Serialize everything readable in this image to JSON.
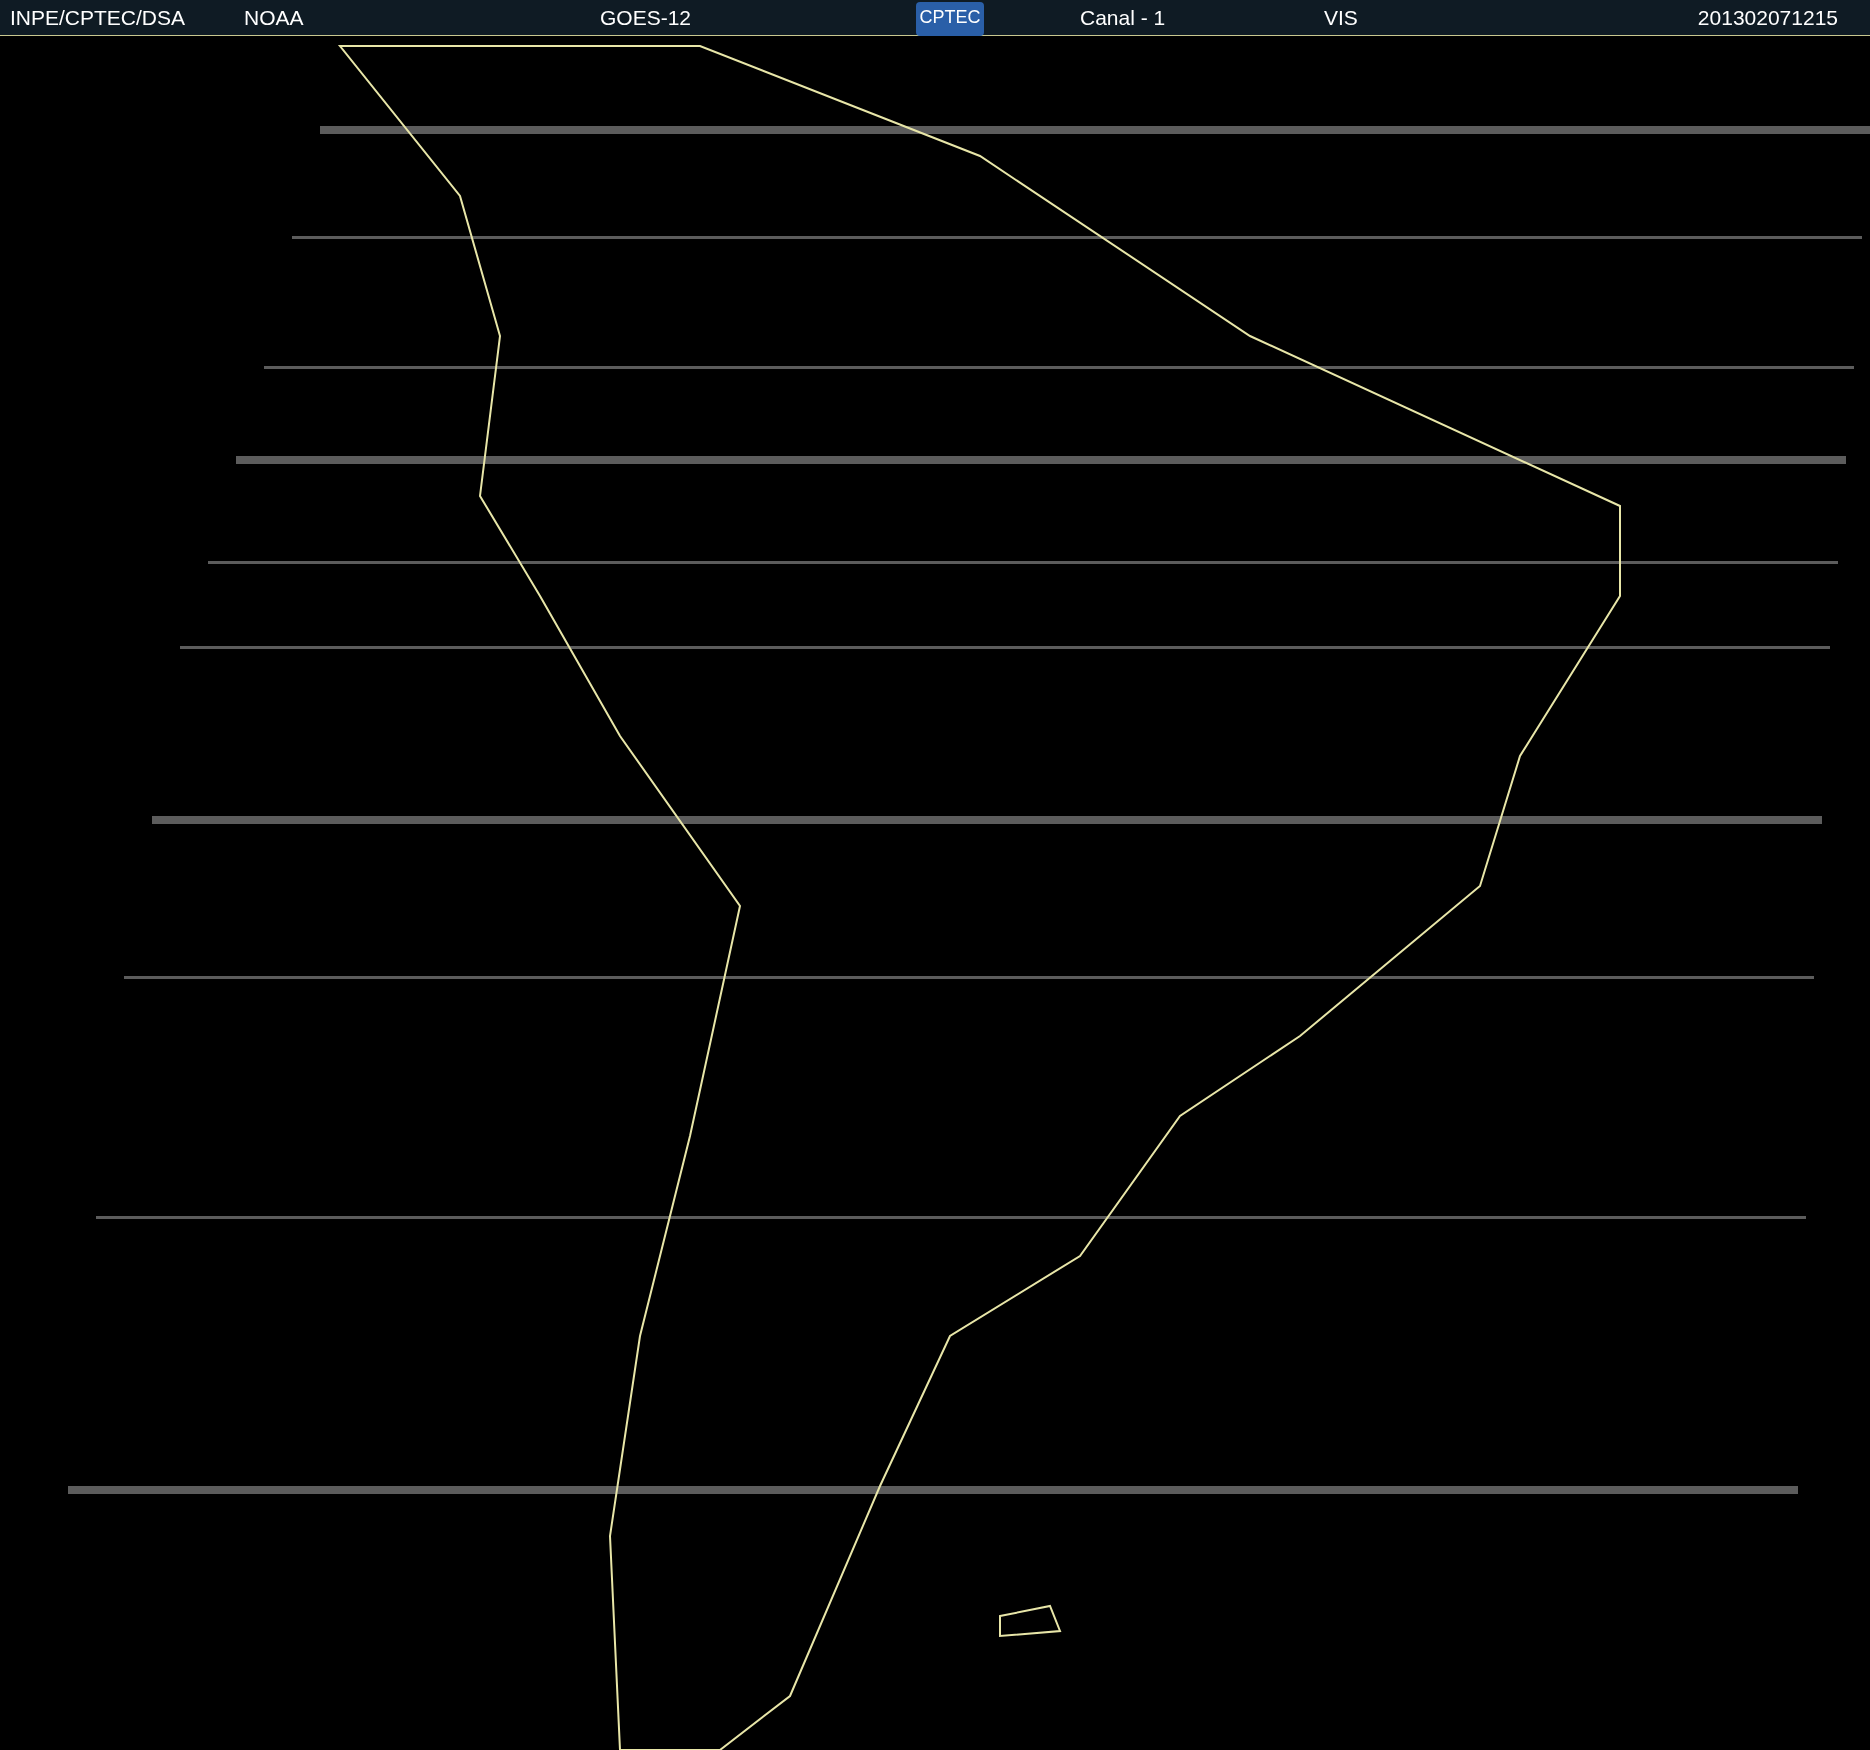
{
  "header": {
    "source": "INPE/CPTEC/DSA",
    "agency": "NOAA",
    "satellite": "GOES-12",
    "logo": "CPTEC",
    "channel": "Canal - 1",
    "band": "VIS",
    "timestamp": "201302071215"
  }
}
